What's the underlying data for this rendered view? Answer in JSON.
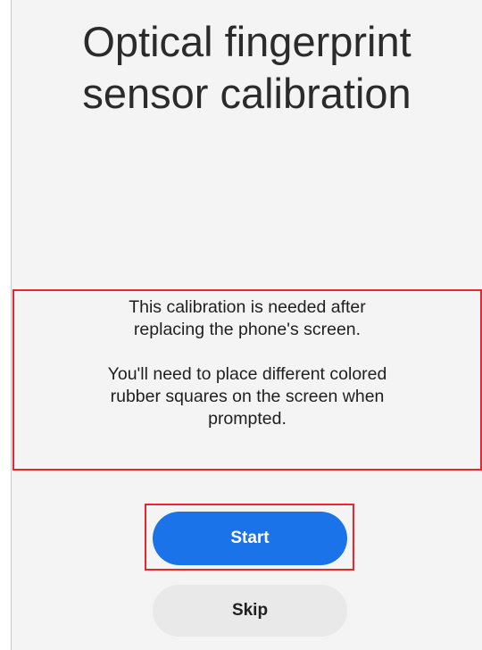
{
  "screen": {
    "title": "Optical fingerprint\nsensor calibration",
    "description": {
      "paragraph1": "This calibration is needed after\nreplacing the phone's screen.",
      "paragraph2": "You'll need to place different colored\nrubber squares on the screen when\nprompted."
    },
    "buttons": {
      "start_label": "Start",
      "skip_label": "Skip"
    }
  },
  "colors": {
    "primary_button": "#1a73e8",
    "secondary_button": "#e9e9e9",
    "highlight_outline": "#e8262c",
    "background": "#f4f4f4"
  }
}
